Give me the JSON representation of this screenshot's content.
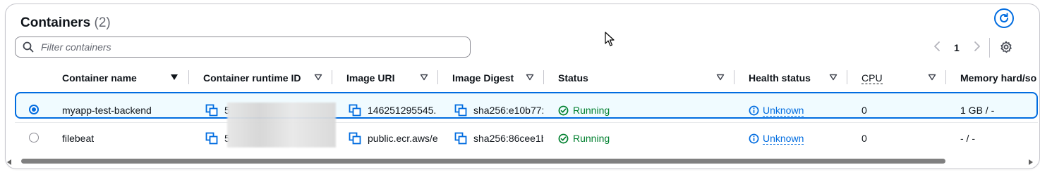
{
  "header": {
    "title": "Containers",
    "count": "(2)"
  },
  "search": {
    "placeholder": "Filter containers",
    "value": ""
  },
  "pagination": {
    "current_page": "1"
  },
  "columns": [
    {
      "label": "Container name"
    },
    {
      "label": "Container runtime ID"
    },
    {
      "label": "Image URI"
    },
    {
      "label": "Image Digest"
    },
    {
      "label": "Status"
    },
    {
      "label": "Health status"
    },
    {
      "label": "CPU"
    },
    {
      "label": "Memory hard/so"
    }
  ],
  "rows": [
    {
      "selected": true,
      "name": "myapp-test-backend",
      "runtime_id": "5",
      "image_uri": "146251295545.",
      "image_digest": "sha256:e10b77:",
      "status": "Running",
      "health": "Unknown",
      "cpu": "0",
      "memory": "1 GB / -"
    },
    {
      "selected": false,
      "name": "filebeat",
      "runtime_id": "5",
      "image_uri": "public.ecr.aws/e",
      "image_digest": "sha256:86cee1b",
      "status": "Running",
      "health": "Unknown",
      "cpu": "0",
      "memory": "- / -"
    }
  ],
  "colors": {
    "accent": "#006ce0",
    "success": "#00802f",
    "row_selected_bg": "#f0fbff"
  },
  "icons": [
    "refresh-icon",
    "search-icon",
    "chevron-left-icon",
    "chevron-right-icon",
    "settings-icon",
    "sort-icon",
    "copy-icon",
    "check-circle-icon",
    "info-icon"
  ]
}
